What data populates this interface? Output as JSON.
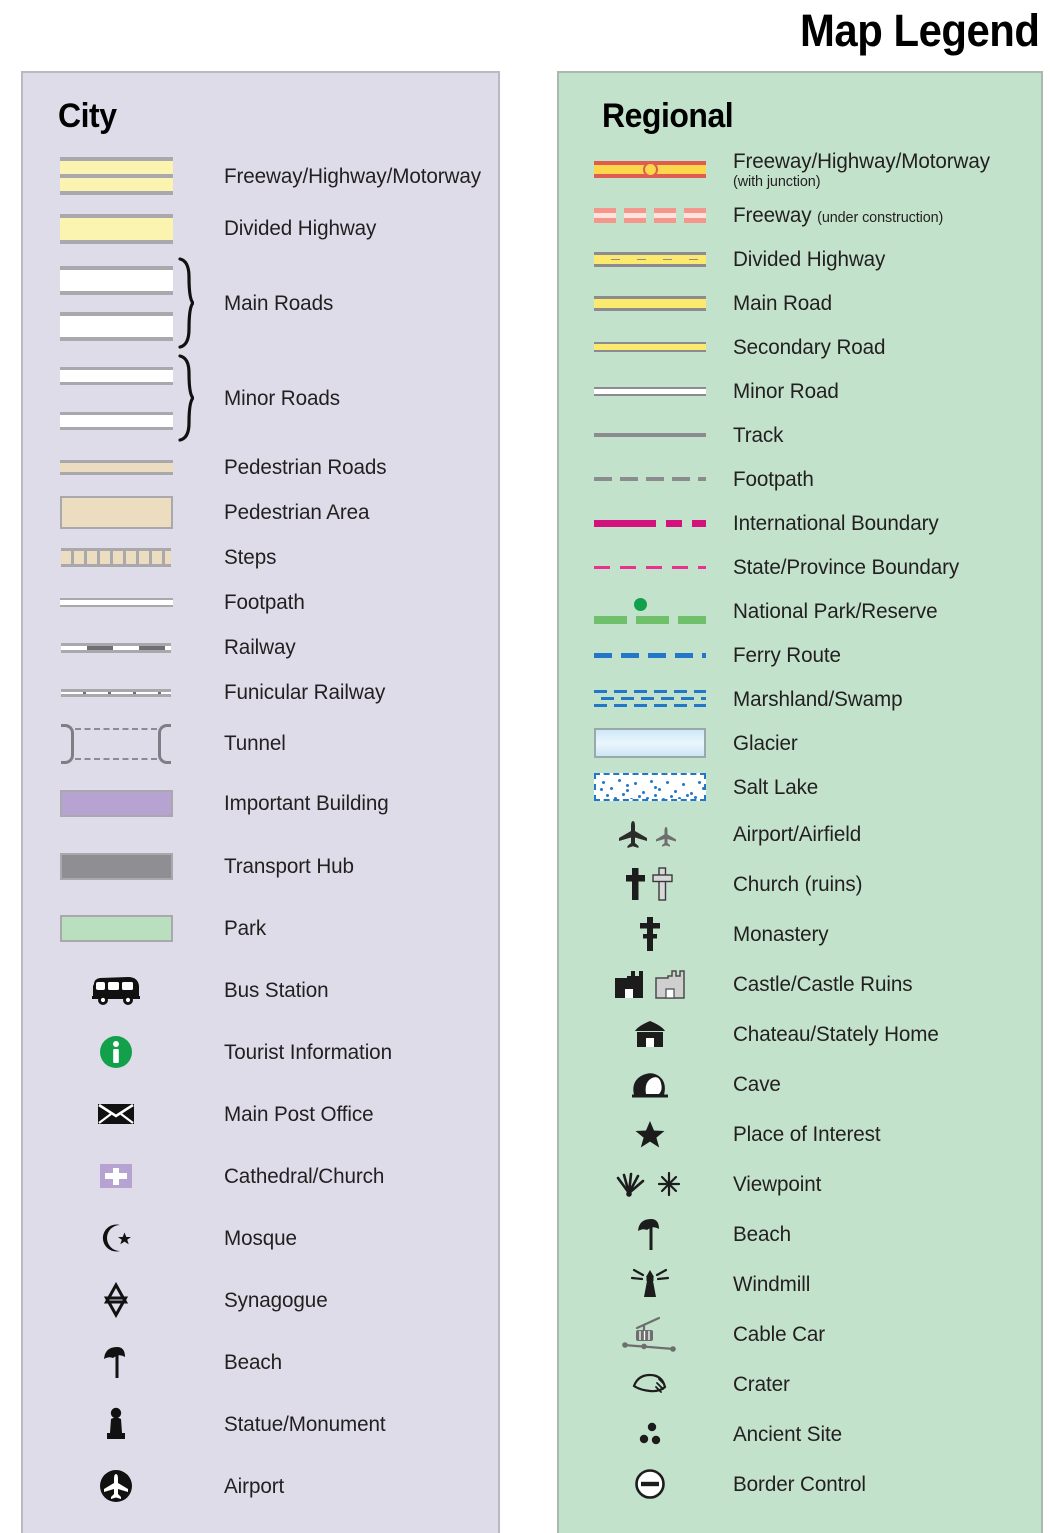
{
  "title": "Map Legend",
  "colors": {
    "city_panel_bg": "#dedce9",
    "regional_panel_bg": "#c3e2cb",
    "panel_border": "#b9b9c2",
    "road_casing": "#a8a8ad",
    "highway_yellow": "#fbf3b0",
    "regional_yellow": "#fcea6e",
    "freeway_red": "#e05c50",
    "freeway_junction": "#fcd64b",
    "pedestrian_tan": "#ecdcc0",
    "important_building": "#b6a3d2",
    "transport_hub": "#8e8e93",
    "park_green": "#b9dfbe",
    "tourist_info_green": "#12a04a",
    "international_boundary": "#d4127e",
    "state_boundary": "#e8328e",
    "national_park": "#6fc06a",
    "ferry_blue": "#2277c8",
    "label_text": "#231f20"
  },
  "city": {
    "heading": "City",
    "items": [
      {
        "label": "Freeway/Highway/Motorway",
        "symbol": "freeway-swatch"
      },
      {
        "label": "Divided Highway",
        "symbol": "divided-highway-swatch"
      },
      {
        "label": "Main Roads",
        "symbol": "main-roads-swatch-braced"
      },
      {
        "label": "Minor Roads",
        "symbol": "minor-roads-swatch-braced"
      },
      {
        "label": "Pedestrian Roads",
        "symbol": "pedestrian-road-swatch"
      },
      {
        "label": "Pedestrian Area",
        "symbol": "pedestrian-area-swatch"
      },
      {
        "label": "Steps",
        "symbol": "steps-swatch"
      },
      {
        "label": "Footpath",
        "symbol": "footpath-swatch"
      },
      {
        "label": "Railway",
        "symbol": "railway-swatch"
      },
      {
        "label": "Funicular Railway",
        "symbol": "funicular-railway-swatch"
      },
      {
        "label": "Tunnel",
        "symbol": "tunnel-swatch"
      },
      {
        "label": "Important Building",
        "symbol": "important-building-swatch"
      },
      {
        "label": "Transport Hub",
        "symbol": "transport-hub-swatch"
      },
      {
        "label": "Park",
        "symbol": "park-swatch"
      },
      {
        "label": "Bus Station",
        "symbol": "bus-icon"
      },
      {
        "label": "Tourist Information",
        "symbol": "tourist-information-icon"
      },
      {
        "label": "Main Post Office",
        "symbol": "envelope-icon"
      },
      {
        "label": "Cathedral/Church",
        "symbol": "church-cross-icon"
      },
      {
        "label": "Mosque",
        "symbol": "crescent-star-icon"
      },
      {
        "label": "Synagogue",
        "symbol": "star-of-david-icon"
      },
      {
        "label": "Beach",
        "symbol": "beach-umbrella-icon"
      },
      {
        "label": "Statue/Monument",
        "symbol": "statue-icon"
      },
      {
        "label": "Airport",
        "symbol": "airport-circle-icon"
      }
    ]
  },
  "regional": {
    "heading": "Regional",
    "items": [
      {
        "label": "Freeway/Highway/Motorway",
        "sublabel": "(with junction)",
        "sub_style": "block",
        "symbol": "regional-freeway-swatch"
      },
      {
        "label": "Freeway",
        "sublabel": "(under construction)",
        "sub_style": "inline",
        "symbol": "regional-freeway-construction-swatch"
      },
      {
        "label": "Divided Highway",
        "symbol": "regional-divided-highway-swatch"
      },
      {
        "label": "Main Road",
        "symbol": "regional-main-road-swatch"
      },
      {
        "label": "Secondary Road",
        "symbol": "regional-secondary-road-swatch"
      },
      {
        "label": "Minor Road",
        "symbol": "regional-minor-road-swatch"
      },
      {
        "label": "Track",
        "symbol": "track-swatch"
      },
      {
        "label": "Footpath",
        "symbol": "regional-footpath-swatch"
      },
      {
        "label": "International Boundary",
        "symbol": "international-boundary-swatch"
      },
      {
        "label": "State/Province Boundary",
        "symbol": "state-boundary-swatch"
      },
      {
        "label": "National Park/Reserve",
        "symbol": "national-park-swatch"
      },
      {
        "label": "Ferry Route",
        "symbol": "ferry-route-swatch"
      },
      {
        "label": "Marshland/Swamp",
        "symbol": "marshland-swatch"
      },
      {
        "label": "Glacier",
        "symbol": "glacier-swatch"
      },
      {
        "label": "Salt Lake",
        "symbol": "salt-lake-swatch"
      },
      {
        "label": "Airport/Airfield",
        "symbol": "airplane-pair-icon"
      },
      {
        "label": "Church (ruins)",
        "symbol": "church-ruins-cross-icon"
      },
      {
        "label": "Monastery",
        "symbol": "monastery-cross-icon"
      },
      {
        "label": "Castle/Castle Ruins",
        "symbol": "castle-pair-icon"
      },
      {
        "label": "Chateau/Stately Home",
        "symbol": "chateau-icon"
      },
      {
        "label": "Cave",
        "symbol": "cave-icon"
      },
      {
        "label": "Place of Interest",
        "symbol": "star-icon"
      },
      {
        "label": "Viewpoint",
        "symbol": "viewpoint-pair-icon"
      },
      {
        "label": "Beach",
        "symbol": "beach-umbrella-icon"
      },
      {
        "label": "Windmill",
        "symbol": "windmill-icon"
      },
      {
        "label": "Cable Car",
        "symbol": "cable-car-icon"
      },
      {
        "label": "Crater",
        "symbol": "crater-icon"
      },
      {
        "label": "Ancient Site",
        "symbol": "ancient-site-icon"
      },
      {
        "label": "Border Control",
        "symbol": "border-control-icon"
      }
    ]
  }
}
